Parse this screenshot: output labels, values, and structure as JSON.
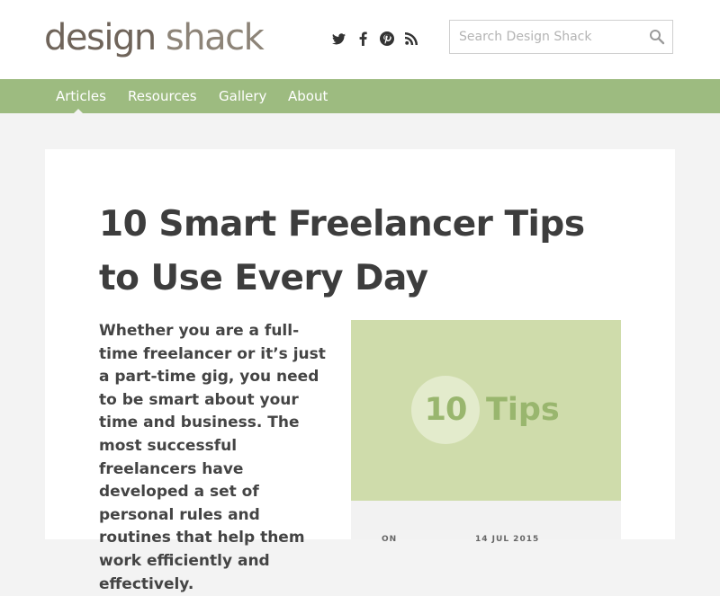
{
  "header": {
    "logo_part1": "design",
    "logo_part2": "shack",
    "social_icons": [
      "twitter-icon",
      "facebook-icon",
      "pinterest-icon",
      "rss-icon"
    ],
    "search": {
      "placeholder": "Search Design Shack"
    }
  },
  "nav": {
    "items": [
      "Articles",
      "Resources",
      "Gallery",
      "About"
    ],
    "active": "Articles"
  },
  "article": {
    "title_line1": "10 Smart Freelancer Tips",
    "title_line2": "to Use Every Day",
    "excerpt": "Whether you are a full-time freelancer or it’s just a part-time gig, you need to be smart about your time and business. The most successful freelancers have developed a set of personal rules and routines that help them work efficiently and effectively.",
    "feature_number": "10",
    "feature_word": "Tips",
    "meta_on": "ON",
    "meta_date": "14 JUL 2015"
  },
  "colors": {
    "nav_bg": "#9dbb80",
    "feature_bg": "#cfdcab",
    "feature_text": "#99b66e",
    "page_bg": "#f3f3f3"
  }
}
